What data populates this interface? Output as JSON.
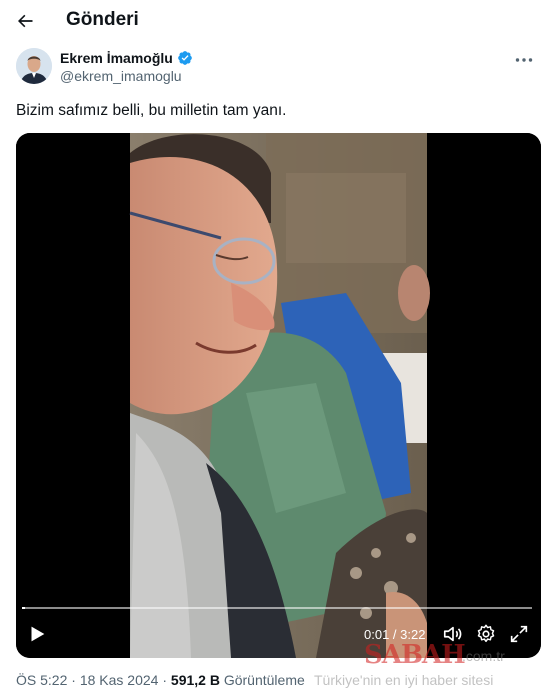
{
  "header": {
    "title": "Gönderi",
    "back_icon": "arrow-left-icon"
  },
  "author": {
    "name": "Ekrem İmamoğlu",
    "handle": "@ekrem_imamoglu",
    "verified": true,
    "verified_color": "#1d9bf0"
  },
  "tweet": {
    "text": "Bizim safımız belli, bu milletin tam yanı."
  },
  "video": {
    "current_time": "0:01",
    "duration": "3:22",
    "time_display": "0:01 / 3:22",
    "progress": 0.005,
    "controls": [
      "play-icon",
      "volume-icon",
      "settings-icon",
      "fullscreen-icon"
    ]
  },
  "meta": {
    "time": "ÖS 5:22",
    "date": "18 Kas 2024",
    "views_count": "591,2 B",
    "views_label": "Görüntüleme",
    "separator": "·"
  },
  "watermark": {
    "logo": "SABAH",
    "domain": ".com.tr",
    "tagline": "Türkiye'nin en iyi haber sitesi"
  },
  "colors": {
    "text_primary": "#0f1419",
    "text_secondary": "#536471",
    "accent": "#1d9bf0"
  }
}
